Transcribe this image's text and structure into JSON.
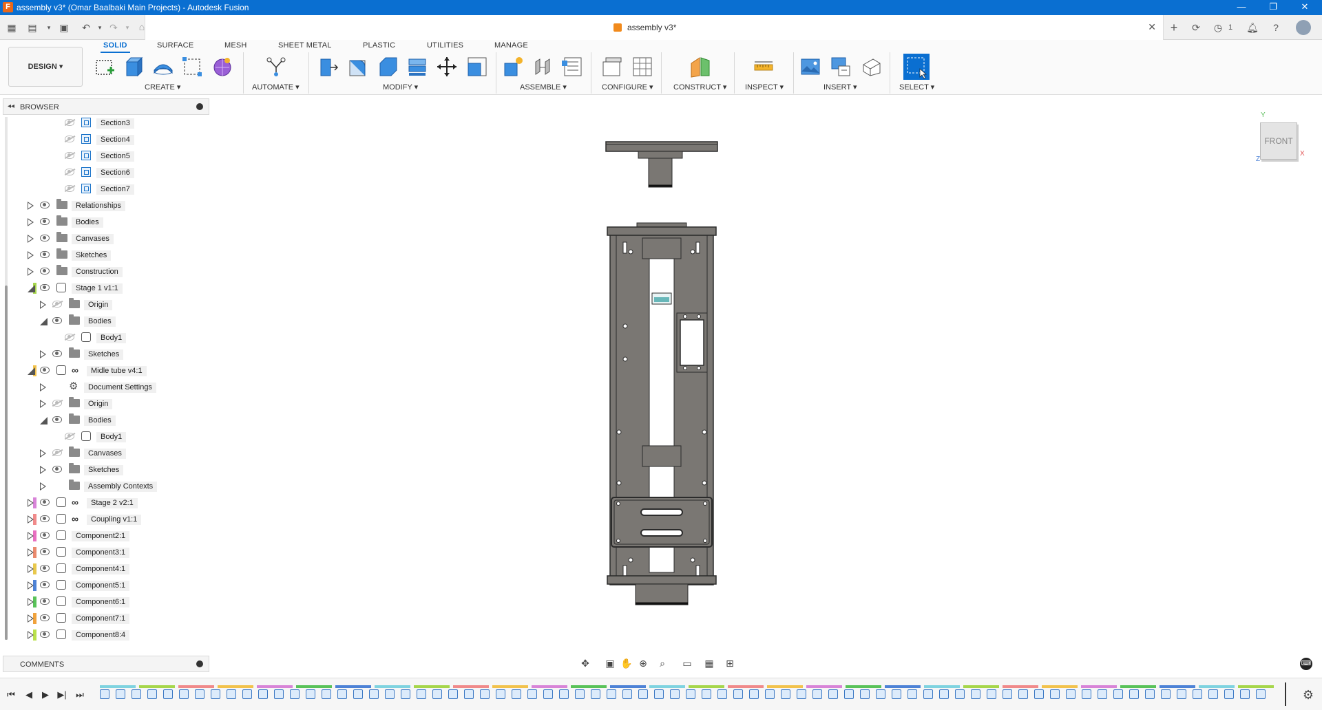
{
  "window": {
    "title": "assembly v3* (Omar Baalbaki Main Projects) - Autodesk Fusion",
    "app_icon_letter": "F",
    "minimize": "—",
    "maximize": "❐",
    "close": "✕"
  },
  "document_tab": {
    "label": "assembly v3*",
    "close": "✕",
    "job_count": "1"
  },
  "design_button": {
    "label": "DESIGN ▾"
  },
  "workspace_tabs": [
    "SOLID",
    "SURFACE",
    "MESH",
    "SHEET METAL",
    "PLASTIC",
    "UTILITIES",
    "MANAGE"
  ],
  "active_workspace_tab": "SOLID",
  "tool_groups": [
    "CREATE ▾",
    "AUTOMATE ▾",
    "MODIFY ▾",
    "ASSEMBLE ▾",
    "CONFIGURE ▾",
    "CONSTRUCT ▾",
    "INSPECT ▾",
    "INSERT ▾",
    "SELECT ▾"
  ],
  "browser": {
    "title": "BROWSER",
    "collapse_glyph": "◂◂",
    "rows": [
      {
        "label": "Section3",
        "indent": 4,
        "icon": "section",
        "eye": "off",
        "tri": ""
      },
      {
        "label": "Section4",
        "indent": 4,
        "icon": "section",
        "eye": "off",
        "tri": ""
      },
      {
        "label": "Section5",
        "indent": 4,
        "icon": "section",
        "eye": "off",
        "tri": ""
      },
      {
        "label": "Section6",
        "indent": 4,
        "icon": "section",
        "eye": "off",
        "tri": ""
      },
      {
        "label": "Section7",
        "indent": 4,
        "icon": "section",
        "eye": "off",
        "tri": ""
      },
      {
        "label": "Relationships",
        "indent": 2,
        "icon": "folder",
        "eye": "on",
        "tri": "closed"
      },
      {
        "label": "Bodies",
        "indent": 2,
        "icon": "folder",
        "eye": "on",
        "tri": "closed"
      },
      {
        "label": "Canvases",
        "indent": 2,
        "icon": "folder",
        "eye": "on",
        "tri": "closed"
      },
      {
        "label": "Sketches",
        "indent": 2,
        "icon": "folder",
        "eye": "on",
        "tri": "closed"
      },
      {
        "label": "Construction",
        "indent": 2,
        "icon": "folder",
        "eye": "on",
        "tri": "closed"
      },
      {
        "label": "Stage 1 v1:1",
        "indent": 2,
        "icon": "component-edit",
        "eye": "on",
        "tri": "open",
        "color": "#a6d64b"
      },
      {
        "label": "Origin",
        "indent": 3,
        "icon": "folder",
        "eye": "off",
        "tri": "closed"
      },
      {
        "label": "Bodies",
        "indent": 3,
        "icon": "folder",
        "eye": "on",
        "tri": "open"
      },
      {
        "label": "Body1",
        "indent": 4,
        "icon": "body",
        "eye": "off",
        "tri": ""
      },
      {
        "label": "Sketches",
        "indent": 3,
        "icon": "folder",
        "eye": "on",
        "tri": "closed"
      },
      {
        "label": "Midle tube v4:1",
        "indent": 2,
        "icon": "component-link",
        "eye": "on",
        "tri": "open",
        "color": "#f2c24c"
      },
      {
        "label": "Document Settings",
        "indent": 3,
        "icon": "gear",
        "eye": "none",
        "tri": "closed"
      },
      {
        "label": "Origin",
        "indent": 3,
        "icon": "folder",
        "eye": "off",
        "tri": "closed"
      },
      {
        "label": "Bodies",
        "indent": 3,
        "icon": "folder",
        "eye": "on",
        "tri": "open"
      },
      {
        "label": "Body1",
        "indent": 4,
        "icon": "body",
        "eye": "off",
        "tri": ""
      },
      {
        "label": "Canvases",
        "indent": 3,
        "icon": "folder",
        "eye": "off",
        "tri": "closed"
      },
      {
        "label": "Sketches",
        "indent": 3,
        "icon": "folder",
        "eye": "on",
        "tri": "closed"
      },
      {
        "label": "Assembly Contexts",
        "indent": 3,
        "icon": "folder",
        "eye": "none",
        "tri": "closed"
      },
      {
        "label": "Stage 2 v2:1",
        "indent": 2,
        "icon": "component-link",
        "eye": "on",
        "tri": "closed",
        "color": "#d884d8"
      },
      {
        "label": "Coupling v1:1",
        "indent": 2,
        "icon": "component-link",
        "eye": "on",
        "tri": "closed",
        "color": "#f08a8a"
      },
      {
        "label": "Component2:1",
        "indent": 2,
        "icon": "component",
        "eye": "on",
        "tri": "closed",
        "color": "#e86fc0"
      },
      {
        "label": "Component3:1",
        "indent": 2,
        "icon": "component",
        "eye": "on",
        "tri": "closed",
        "color": "#e98a6d"
      },
      {
        "label": "Component4:1",
        "indent": 2,
        "icon": "component",
        "eye": "on",
        "tri": "closed",
        "color": "#e8c84c"
      },
      {
        "label": "Component5:1",
        "indent": 2,
        "icon": "component",
        "eye": "on",
        "tri": "closed",
        "color": "#4d82d6"
      },
      {
        "label": "Component6:1",
        "indent": 2,
        "icon": "component",
        "eye": "on",
        "tri": "closed",
        "color": "#59c259"
      },
      {
        "label": "Component7:1",
        "indent": 2,
        "icon": "component",
        "eye": "on",
        "tri": "closed",
        "color": "#f0a23c"
      },
      {
        "label": "Component8:4",
        "indent": 2,
        "icon": "component",
        "eye": "on",
        "tri": "closed",
        "color": "#b9e04a"
      }
    ]
  },
  "comments": {
    "title": "COMMENTS"
  },
  "viewcube": {
    "face": "FRONT",
    "x": "X",
    "y": "Y",
    "z": "Z"
  },
  "colors": {
    "title_bar": "#0a6fd1",
    "accent": "#0a6fd1",
    "model_gray": "#7a7773",
    "model_dark": "#2b2b2b"
  }
}
